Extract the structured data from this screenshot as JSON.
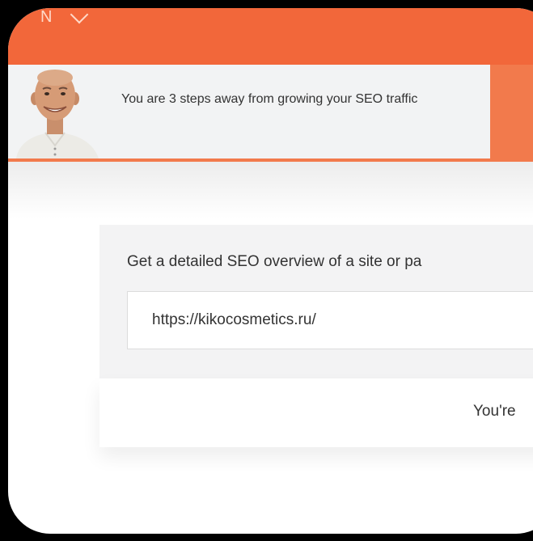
{
  "colors": {
    "brand_orange": "#f2673a",
    "banner_orange": "#f27a4c",
    "panel_gray": "#f3f3f4"
  },
  "header": {
    "menu_icon": "chevron-down-icon"
  },
  "banner": {
    "message": "You are 3 steps away from growing your SEO traffic",
    "avatar_icon": "person-avatar"
  },
  "seo_tool": {
    "heading": "Get a detailed SEO overview of a site or pa",
    "url_value": "https://kikocosmetics.ru/"
  },
  "status": {
    "text": "You're"
  }
}
